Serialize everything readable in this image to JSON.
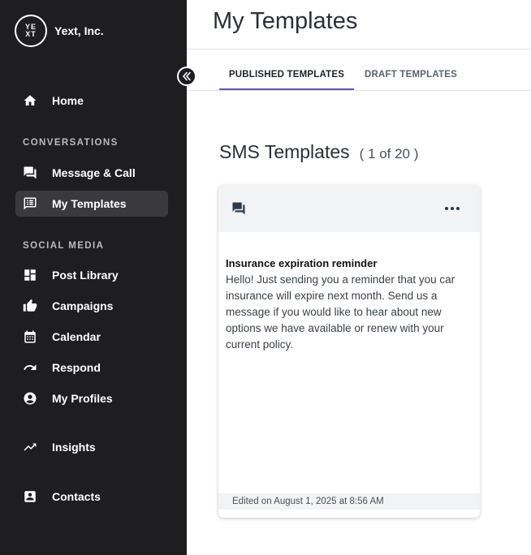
{
  "brand": {
    "logo_top": "YE",
    "logo_bottom": "XT",
    "name": "Yext, Inc."
  },
  "sidebar": {
    "home": "Home",
    "section_conversations": "CONVERSATIONS",
    "message_call": "Message & Call",
    "my_templates": "My Templates",
    "section_social": "SOCIAL MEDIA",
    "post_library": "Post Library",
    "campaigns": "Campaigns",
    "calendar": "Calendar",
    "respond": "Respond",
    "my_profiles": "My Profiles",
    "insights": "Insights",
    "contacts": "Contacts",
    "active_item": "My Templates"
  },
  "header": {
    "title": "My Templates"
  },
  "tabs": [
    {
      "label": "PUBLISHED TEMPLATES",
      "active": true
    },
    {
      "label": "DRAFT TEMPLATES",
      "active": false
    }
  ],
  "section": {
    "title": "SMS Templates",
    "count": "( 1 of 20 )"
  },
  "card": {
    "title": "Insurance expiration reminder",
    "body": "Hello! Just sending you a reminder that you car insurance will expire next month. Send us a message if you would like to hear about new options we have available or renew with your current policy.",
    "footer": "Edited on August 1, 2025 at 8:56 AM"
  },
  "colors": {
    "sidebar_bg": "#1e1e20",
    "active_bg": "#3a3a3e",
    "accent": "#5a4fcf"
  },
  "icons": {
    "collapse": "double-chevron-left-icon",
    "home": "home-icon",
    "message": "chat-bubbles-icon",
    "templates": "template-icon",
    "post_library": "dashboard-icon",
    "campaigns": "thumbs-up-icon",
    "calendar": "calendar-icon",
    "respond": "reply-icon",
    "profiles": "account-circle-icon",
    "insights": "trending-up-icon",
    "contacts": "contact-card-icon",
    "card_more": "more-horizontal-icon"
  }
}
